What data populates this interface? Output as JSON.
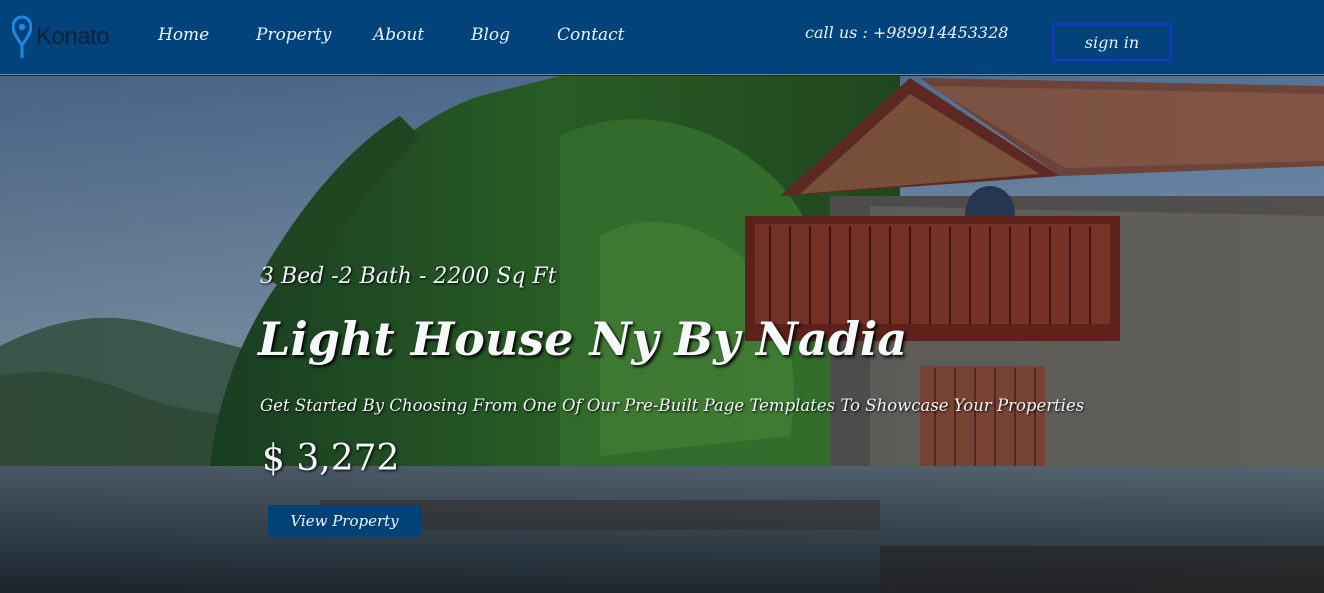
{
  "brand": {
    "name": "Konato"
  },
  "nav": {
    "items": [
      {
        "label": "Home"
      },
      {
        "label": "Property"
      },
      {
        "label": "About"
      },
      {
        "label": "Blog"
      },
      {
        "label": "Contact"
      }
    ],
    "call": "call us : +989914453328",
    "signin_label": "sign in"
  },
  "hero": {
    "specs": "3 Bed -2 Bath - 2200 Sq Ft",
    "title": "Light House Ny By Nadia",
    "description": "Get Started By Choosing From One Of Our Pre-Built Page Templates To Showcase Your Properties",
    "price": "$ 3,272",
    "cta_label": "View Property"
  },
  "colors": {
    "nav_bg": "#01437a",
    "signin_border": "#1b33d9",
    "cta_bg": "#024277",
    "logo_pin": "#1e88e5"
  },
  "icons": {
    "logo": "map-pin-icon"
  }
}
